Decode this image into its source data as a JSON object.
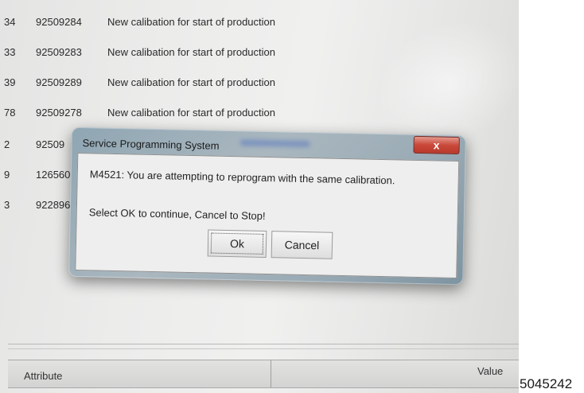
{
  "calibration_rows": [
    {
      "idx": "34",
      "number": "92509284",
      "description": "New calibation for start of production"
    },
    {
      "idx": "33",
      "number": "92509283",
      "description": "New calibation for start of production"
    },
    {
      "idx": "39",
      "number": "92509289",
      "description": "New calibation for start of production"
    },
    {
      "idx": "78",
      "number": "92509278",
      "description": "New calibation for start of production"
    },
    {
      "idx": "2",
      "number": "92509",
      "description": ""
    },
    {
      "idx": "9",
      "number": "126560",
      "description": ""
    },
    {
      "idx": "3",
      "number": "922896",
      "description": ""
    }
  ],
  "dialog": {
    "title": "Service Programming System",
    "close_label": "x",
    "message_line_1": "M4521: You are attempting to reprogram with the same calibration.",
    "message_line_2": "Select OK to continue, Cancel to Stop!",
    "ok_label": "Ok",
    "cancel_label": "Cancel"
  },
  "table_header": {
    "attribute_label": "Attribute",
    "value_label": "Value"
  },
  "image_id": "5045242"
}
